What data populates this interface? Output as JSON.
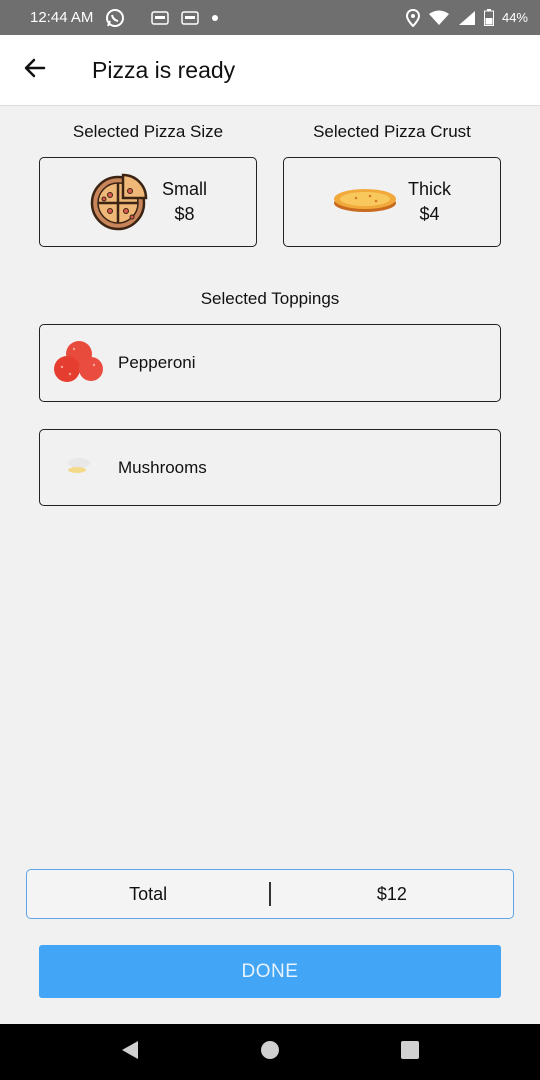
{
  "status_bar": {
    "time": "12:44 AM",
    "battery": "44%",
    "icons": [
      "whatsapp-icon",
      "app-icon",
      "app-icon",
      "dot-icon",
      "location-icon",
      "wifi-icon",
      "signal-icon",
      "battery-icon"
    ]
  },
  "app_bar": {
    "back_icon": "arrow-left-icon",
    "title": "Pizza is ready"
  },
  "size_section": {
    "label": "Selected Pizza Size",
    "name": "Small",
    "price": "$8",
    "icon": "pizza-icon"
  },
  "crust_section": {
    "label": "Selected Pizza Crust",
    "name": "Thick",
    "price": "$4",
    "icon": "pizza-crust-icon"
  },
  "toppings_section": {
    "label": "Selected Toppings",
    "items": [
      {
        "label": "Pepperoni",
        "icon": "pepperoni-icon"
      },
      {
        "label": "Mushrooms",
        "icon": "mushroom-icon"
      }
    ]
  },
  "total": {
    "label": "Total",
    "value": "$12"
  },
  "done_button": {
    "label": "DONE"
  },
  "colors": {
    "accent": "#42a5f5",
    "total_border": "#5fa6e6",
    "background": "#f1f1f1",
    "status_bar": "#6f6f6f"
  }
}
